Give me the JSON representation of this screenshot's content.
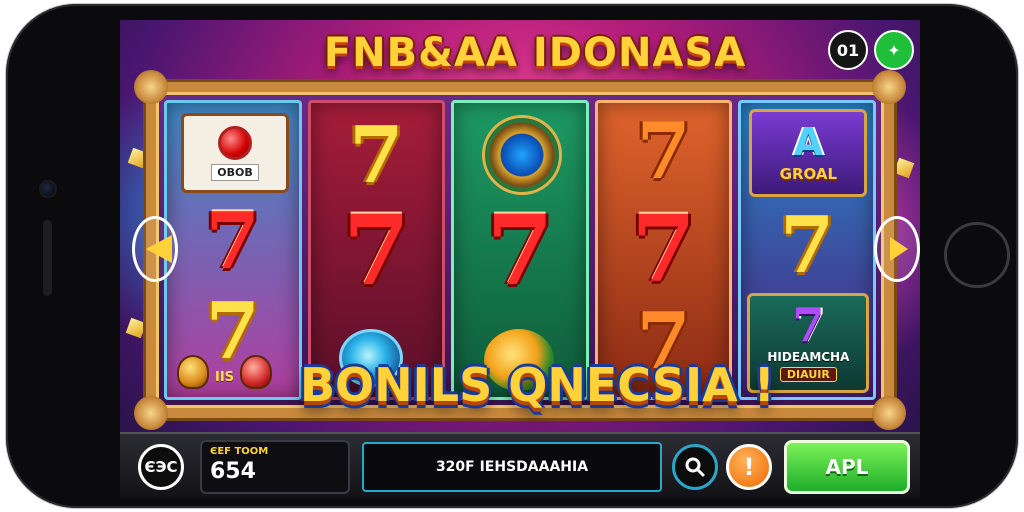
{
  "game": {
    "title": "FNB&AA IDONASA",
    "top_icons": [
      {
        "icon": "counter-badge",
        "label": "01"
      },
      {
        "icon": "running-figure-icon",
        "label": "✦"
      }
    ]
  },
  "reels": [
    {
      "top_card_label": "OBOB",
      "sevens": [
        "7",
        "7"
      ],
      "bottom_label": "IIS"
    },
    {
      "sevens": [
        "7",
        "7"
      ]
    },
    {
      "sevens": [
        "7"
      ]
    },
    {
      "sevens": [
        "7",
        "7",
        "7"
      ]
    },
    {
      "top_card_letter": "A",
      "top_card_label": "GROAL",
      "sevens": [
        "7",
        "7"
      ],
      "bottom_card_label": "HIDEAMCHA",
      "bottom_card_sub": "DIAUIR"
    }
  ],
  "banner": {
    "text": "BONILS QNECSIA !"
  },
  "controls": {
    "close_label": "ЄЭC",
    "balance_label": "ЄEF TOOM",
    "balance_value": "654",
    "message": "320F IEHSDAAAHIA",
    "search_icon": "search-icon",
    "info_label": "!",
    "action_label": "APL"
  },
  "colors": {
    "accent_gold": "#ffd23a",
    "button_green": "#1fae2a",
    "info_orange": "#f06a00"
  }
}
